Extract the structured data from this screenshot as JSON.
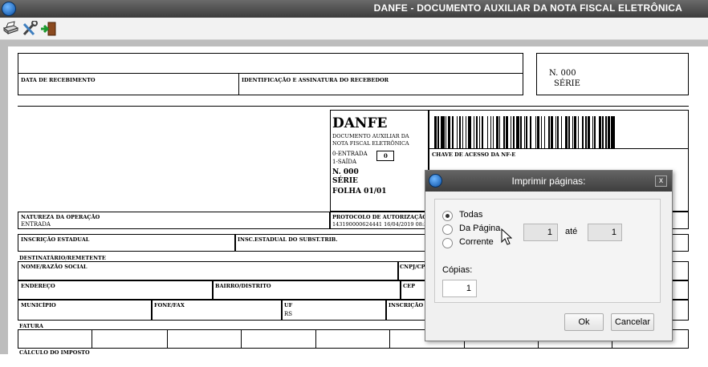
{
  "window": {
    "title": "DANFE - DOCUMENTO AUXILIAR DA NOTA FISCAL ELETRÔNICA"
  },
  "toolbar": {
    "buttons": [
      "printer-icon",
      "tools-icon",
      "exit-icon"
    ]
  },
  "danfe": {
    "top": {
      "data_recebimento": "DATA DE RECEBIMENTO",
      "identificacao": "IDENTIFICAÇÃO E ASSINATURA DO RECEBEDOR",
      "numero": "N. 000",
      "serie": "SÉRIE"
    },
    "header": {
      "title": "DANFE",
      "subtitle_1": "DOCUMENTO AUXILIAR DA",
      "subtitle_2": "NOTA FISCAL ELETRÔNICA",
      "entrada": "0-ENTRADA",
      "saida": "1-SAÍDA",
      "tipo": "0",
      "numero": "N. 000",
      "serie": "SÉRIE",
      "folha": "FOLHA 01/01",
      "chave_label": "CHAVE DE ACESSO DA NF-E"
    },
    "fields": {
      "natureza_label": "NATUREZA DA OPERAÇÃO",
      "natureza_value": "ENTRADA",
      "protocolo_label": "PROTOCOLO DE AUTORIZAÇÃO D",
      "protocolo_value": "143190000624441 16/04/2019 08:3",
      "ie_label": "INSCRIÇÃO ESTADUAL",
      "ie_st_label": "INSC.ESTADUAL DO SUBST.TRIB.",
      "destinatario_label": "DESTINATÁRIO/REMETENTE",
      "nome_label": "NOME/RAZÃO SOCIAL",
      "cnpj_label": "CNPJ/CP",
      "endereco_label": "ENDEREÇO",
      "bairro_label": "BAIRRO/DISTRITO",
      "cep_label": "CEP",
      "municipio_label": "MUNICÍPIO",
      "fone_label": "FONE/FAX",
      "uf_label": "UF",
      "uf_value": "RS",
      "inscricao_label": "INSCRIÇÃO E",
      "fatura_label": "FATURA",
      "calculo_label": "CÁLCULO DO IMPOSTO"
    }
  },
  "dialog": {
    "title": "Imprimir páginas:",
    "close": "x",
    "options": {
      "todas": "Todas",
      "da_pagina": "Da Página",
      "corrente": "Corrente",
      "selected": "Todas"
    },
    "from_page": "1",
    "ate": "até",
    "to_page": "1",
    "copias_label": "Cópias:",
    "copias_value": "1",
    "ok": "Ok",
    "cancelar": "Cancelar"
  }
}
